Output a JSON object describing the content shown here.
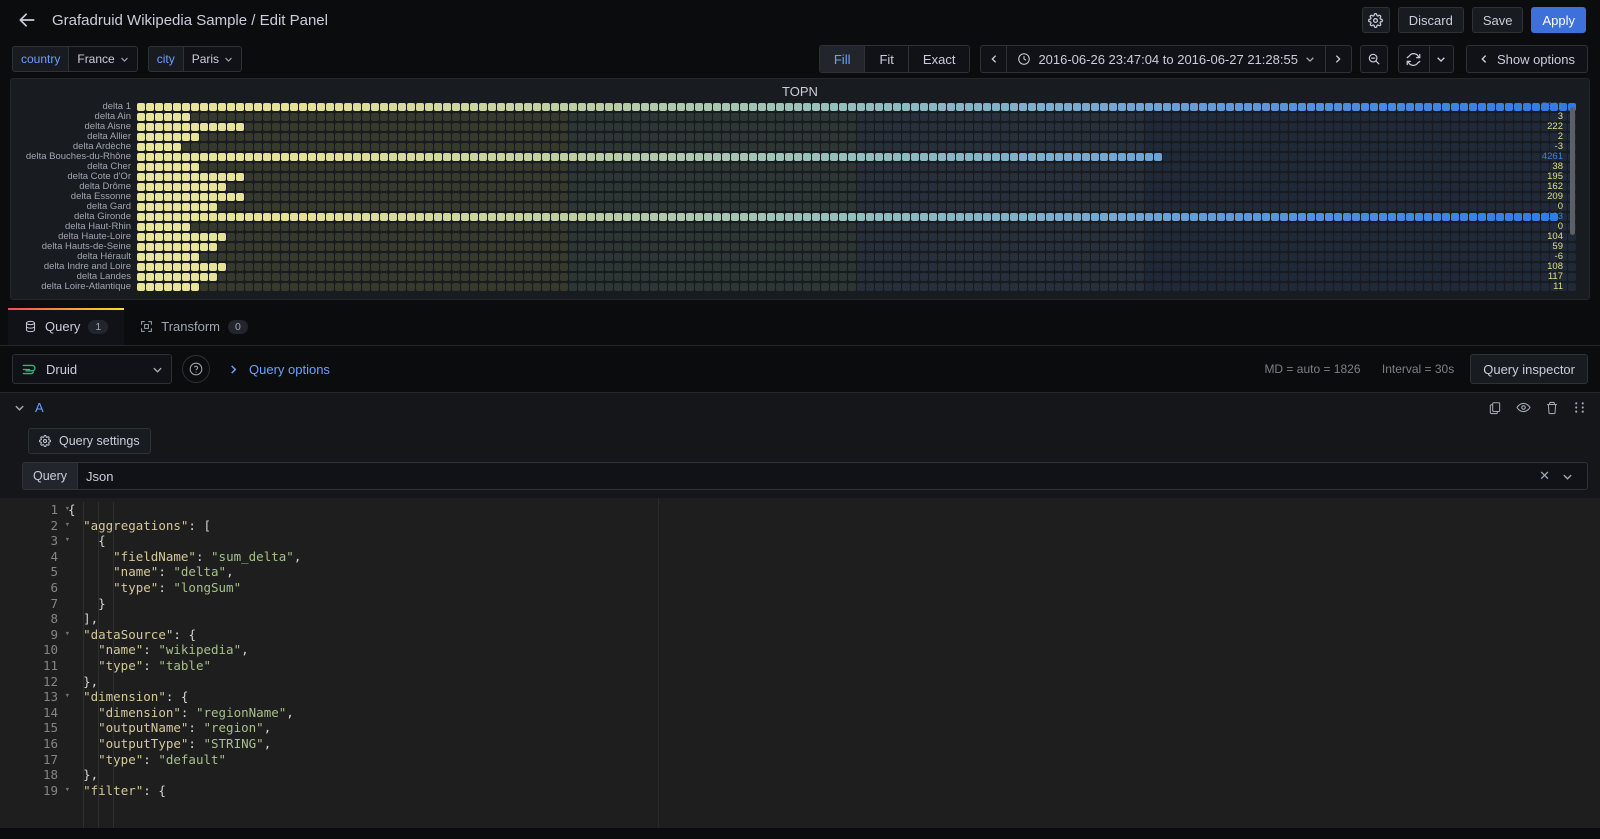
{
  "header": {
    "back_icon": "arrow-left-icon",
    "title": "Grafadruid Wikipedia Sample / Edit Panel",
    "settings_icon": "gear-icon",
    "discard_label": "Discard",
    "save_label": "Save",
    "apply_label": "Apply"
  },
  "variables": [
    {
      "label": "country",
      "value": "France"
    },
    {
      "label": "city",
      "value": "Paris"
    }
  ],
  "toolbar": {
    "size_modes": [
      "Fill",
      "Fit",
      "Exact"
    ],
    "active_size_mode": "Fill",
    "prev_icon": "chevron-left-icon",
    "next_icon": "chevron-right-icon",
    "clock_icon": "clock-icon",
    "time_range": "2016-06-26 23:47:04 to 2016-06-27 21:28:55",
    "time_caret_icon": "chevron-down-icon",
    "zoom_out_icon": "zoom-out-icon",
    "refresh_icon": "refresh-icon",
    "refresh_caret_icon": "chevron-down-icon",
    "show_options_label": "Show options",
    "show_options_icon": "chevron-left-icon"
  },
  "panel": {
    "title": "TOPN"
  },
  "chart_data": {
    "type": "heatmap",
    "title": "TOPN",
    "xlabel": "",
    "ylabel": "",
    "colorscale": [
      "#e8e49a",
      "#c9d79f",
      "#9ec6b8",
      "#6fa9cf",
      "#3b7fe0",
      "#1c2a3d"
    ],
    "columns": 160,
    "rows": [
      {
        "label": "delta 1",
        "value": "5891",
        "value_color": "#3b7fe0",
        "filled": 160,
        "bright": 160
      },
      {
        "label": "delta Ain",
        "value": "3",
        "value_color": "#e0dd8a",
        "filled": 6,
        "bright": 6
      },
      {
        "label": "delta Aisne",
        "value": "222",
        "value_color": "#e0dd8a",
        "filled": 12,
        "bright": 12
      },
      {
        "label": "delta Allier",
        "value": "2",
        "value_color": "#e0dd8a",
        "filled": 7,
        "bright": 7
      },
      {
        "label": "delta Ardèche",
        "value": "-3",
        "value_color": "#e0dd8a",
        "filled": 5,
        "bright": 5
      },
      {
        "label": "delta Bouches-du-Rhône",
        "value": "4261",
        "value_color": "#3b7fe0",
        "filled": 114,
        "bright": 114
      },
      {
        "label": "delta Cher",
        "value": "38",
        "value_color": "#e0dd8a",
        "filled": 7,
        "bright": 7
      },
      {
        "label": "delta Cote d'Or",
        "value": "195",
        "value_color": "#e0dd8a",
        "filled": 12,
        "bright": 12
      },
      {
        "label": "delta Drôme",
        "value": "162",
        "value_color": "#e0dd8a",
        "filled": 10,
        "bright": 10
      },
      {
        "label": "delta Essonne",
        "value": "209",
        "value_color": "#e0dd8a",
        "filled": 12,
        "bright": 12
      },
      {
        "label": "delta Gard",
        "value": "0",
        "value_color": "#e0dd8a",
        "filled": 9,
        "bright": 9
      },
      {
        "label": "delta Gironde",
        "value": "6093",
        "value_color": "#3b7fe0",
        "filled": 158,
        "bright": 158
      },
      {
        "label": "delta Haut-Rhin",
        "value": "0",
        "value_color": "#e0dd8a",
        "filled": 6,
        "bright": 6
      },
      {
        "label": "delta Haute-Loire",
        "value": "104",
        "value_color": "#e0dd8a",
        "filled": 10,
        "bright": 10
      },
      {
        "label": "delta Hauts-de-Seine",
        "value": "59",
        "value_color": "#e0dd8a",
        "filled": 9,
        "bright": 9
      },
      {
        "label": "delta Hérault",
        "value": "-6",
        "value_color": "#e0dd8a",
        "filled": 7,
        "bright": 7
      },
      {
        "label": "delta Indre and Loire",
        "value": "108",
        "value_color": "#e0dd8a",
        "filled": 10,
        "bright": 10
      },
      {
        "label": "delta Landes",
        "value": "117",
        "value_color": "#e0dd8a",
        "filled": 9,
        "bright": 9
      },
      {
        "label": "delta Loire-Atlantique",
        "value": "11",
        "value_color": "#e0dd8a",
        "filled": 7,
        "bright": 7
      }
    ]
  },
  "tabs": [
    {
      "label": "Query",
      "badge": "1",
      "icon": "database-icon",
      "active": true
    },
    {
      "label": "Transform",
      "badge": "0",
      "icon": "transform-icon",
      "active": false
    }
  ],
  "datasource": {
    "icon": "druid-icon",
    "name": "Druid",
    "caret_icon": "chevron-down-icon",
    "help_icon": "question-circle-icon",
    "query_options_label": "Query options",
    "query_options_caret": "chevron-right-icon",
    "max_data_points": "MD = auto = 1826",
    "interval": "Interval = 30s",
    "query_inspector_label": "Query inspector"
  },
  "query": {
    "caret_icon": "chevron-down-icon",
    "name": "A",
    "actions": [
      "copy-icon",
      "eye-icon",
      "trash-icon",
      "drag-handle-icon"
    ],
    "settings_label": "Query settings",
    "settings_icon": "gear-icon",
    "field_label": "Query",
    "field_value": "Json",
    "clear_icon": "close-icon",
    "field_caret_icon": "chevron-down-icon"
  },
  "code": {
    "lines": [
      {
        "n": "1",
        "indent": 0,
        "foldable": true,
        "tokens": [
          [
            "brace",
            "{"
          ]
        ]
      },
      {
        "n": "2",
        "indent": 1,
        "foldable": true,
        "tokens": [
          [
            "key",
            "\"aggregations\""
          ],
          [
            "punc",
            ": "
          ],
          [
            "brace",
            "["
          ]
        ]
      },
      {
        "n": "3",
        "indent": 2,
        "foldable": true,
        "tokens": [
          [
            "brace",
            "{"
          ]
        ]
      },
      {
        "n": "4",
        "indent": 3,
        "foldable": false,
        "tokens": [
          [
            "key",
            "\"fieldName\""
          ],
          [
            "punc",
            ": "
          ],
          [
            "str",
            "\"sum_delta\""
          ],
          [
            "punc",
            ","
          ]
        ]
      },
      {
        "n": "5",
        "indent": 3,
        "foldable": false,
        "tokens": [
          [
            "key",
            "\"name\""
          ],
          [
            "punc",
            ": "
          ],
          [
            "str",
            "\"delta\""
          ],
          [
            "punc",
            ","
          ]
        ]
      },
      {
        "n": "6",
        "indent": 3,
        "foldable": false,
        "tokens": [
          [
            "key",
            "\"type\""
          ],
          [
            "punc",
            ": "
          ],
          [
            "str",
            "\"longSum\""
          ]
        ]
      },
      {
        "n": "7",
        "indent": 2,
        "foldable": false,
        "tokens": [
          [
            "brace",
            "}"
          ]
        ]
      },
      {
        "n": "8",
        "indent": 1,
        "foldable": false,
        "tokens": [
          [
            "brace",
            "]"
          ],
          [
            "punc",
            ","
          ]
        ]
      },
      {
        "n": "9",
        "indent": 1,
        "foldable": true,
        "tokens": [
          [
            "key",
            "\"dataSource\""
          ],
          [
            "punc",
            ": "
          ],
          [
            "brace",
            "{"
          ]
        ]
      },
      {
        "n": "10",
        "indent": 2,
        "foldable": false,
        "tokens": [
          [
            "key",
            "\"name\""
          ],
          [
            "punc",
            ": "
          ],
          [
            "str",
            "\"wikipedia\""
          ],
          [
            "punc",
            ","
          ]
        ]
      },
      {
        "n": "11",
        "indent": 2,
        "foldable": false,
        "tokens": [
          [
            "key",
            "\"type\""
          ],
          [
            "punc",
            ": "
          ],
          [
            "str",
            "\"table\""
          ]
        ]
      },
      {
        "n": "12",
        "indent": 1,
        "foldable": false,
        "tokens": [
          [
            "brace",
            "}"
          ],
          [
            "punc",
            ","
          ]
        ]
      },
      {
        "n": "13",
        "indent": 1,
        "foldable": true,
        "tokens": [
          [
            "key",
            "\"dimension\""
          ],
          [
            "punc",
            ": "
          ],
          [
            "brace",
            "{"
          ]
        ]
      },
      {
        "n": "14",
        "indent": 2,
        "foldable": false,
        "tokens": [
          [
            "key",
            "\"dimension\""
          ],
          [
            "punc",
            ": "
          ],
          [
            "str",
            "\"regionName\""
          ],
          [
            "punc",
            ","
          ]
        ]
      },
      {
        "n": "15",
        "indent": 2,
        "foldable": false,
        "tokens": [
          [
            "key",
            "\"outputName\""
          ],
          [
            "punc",
            ": "
          ],
          [
            "str",
            "\"region\""
          ],
          [
            "punc",
            ","
          ]
        ]
      },
      {
        "n": "16",
        "indent": 2,
        "foldable": false,
        "tokens": [
          [
            "key",
            "\"outputType\""
          ],
          [
            "punc",
            ": "
          ],
          [
            "str",
            "\"STRING\""
          ],
          [
            "punc",
            ","
          ]
        ]
      },
      {
        "n": "17",
        "indent": 2,
        "foldable": false,
        "tokens": [
          [
            "key",
            "\"type\""
          ],
          [
            "punc",
            ": "
          ],
          [
            "str",
            "\"default\""
          ]
        ]
      },
      {
        "n": "18",
        "indent": 1,
        "foldable": false,
        "tokens": [
          [
            "brace",
            "}"
          ],
          [
            "punc",
            ","
          ]
        ]
      },
      {
        "n": "19",
        "indent": 1,
        "foldable": true,
        "tokens": [
          [
            "key",
            "\"filter\""
          ],
          [
            "punc",
            ": "
          ],
          [
            "brace",
            "{"
          ]
        ]
      }
    ]
  }
}
